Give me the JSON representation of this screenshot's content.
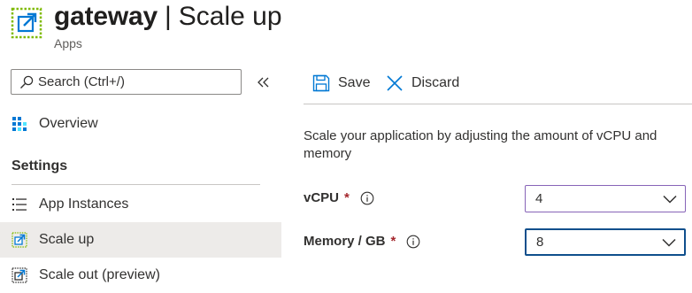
{
  "header": {
    "name": "gateway",
    "separator": "|",
    "blade": "Scale up",
    "subtitle": "Apps",
    "icon": "scale-up-icon"
  },
  "sidebar": {
    "search_placeholder": "Search (Ctrl+/)",
    "collapse_glyph": "«",
    "items": [
      {
        "label": "Overview",
        "icon": "grid-icon"
      },
      {
        "label": "App Instances",
        "icon": "list-icon"
      },
      {
        "label": "Scale up",
        "icon": "scale-up-icon",
        "selected": true
      },
      {
        "label": "Scale out (preview)",
        "icon": "scale-out-icon"
      }
    ],
    "section_header": "Settings"
  },
  "toolbar": {
    "save_label": "Save",
    "discard_label": "Discard"
  },
  "main": {
    "description": "Scale your application by adjusting the amount of vCPU and memory",
    "vcpu": {
      "label": "vCPU",
      "required": "*",
      "value": "4"
    },
    "memory": {
      "label": "Memory / GB",
      "required": "*",
      "value": "8"
    }
  },
  "colors": {
    "accent": "#0078d4",
    "required": "#a4262c",
    "selected_bg": "#edebe9",
    "focus_border": "#0f4f8c"
  }
}
